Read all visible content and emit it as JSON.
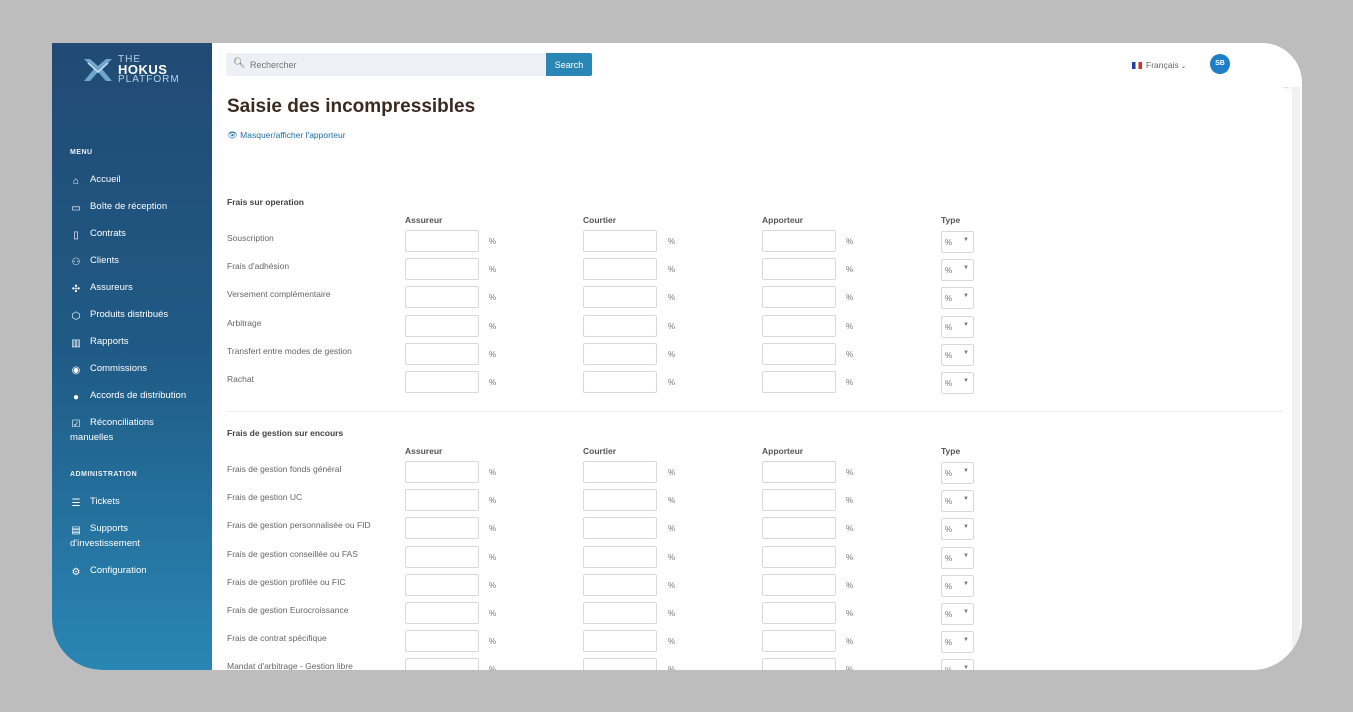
{
  "brand": {
    "line1": "THE",
    "line2": "HOKUS",
    "line3": "PLATFORM"
  },
  "sidebar": {
    "menu_title": "MENU",
    "items": [
      {
        "label": "Accueil",
        "icon": "home-icon"
      },
      {
        "label": "Boîte de réception",
        "icon": "inbox-icon"
      },
      {
        "label": "Contrats",
        "icon": "clipboard-icon"
      },
      {
        "label": "Clients",
        "icon": "users-icon"
      },
      {
        "label": "Assureurs",
        "icon": "handshake-icon"
      },
      {
        "label": "Produits distribués",
        "icon": "cube-icon"
      },
      {
        "label": "Rapports",
        "icon": "books-icon"
      },
      {
        "label": "Commissions",
        "icon": "coins-icon"
      },
      {
        "label": "Accords de distribution",
        "icon": "chat-icon"
      },
      {
        "label": "Réconciliations manuelles",
        "icon": "check-square-icon"
      }
    ],
    "admin_title": "ADMINISTRATION",
    "admin_items": [
      {
        "label": "Tickets",
        "icon": "list-check-icon"
      },
      {
        "label": "Supports d'investissement",
        "icon": "id-card-icon"
      },
      {
        "label": "Configuration",
        "icon": "gear-icon"
      }
    ]
  },
  "topbar": {
    "search_placeholder": "Rechercher",
    "search_button": "Search",
    "language": "Français",
    "user_initials": "SB"
  },
  "page": {
    "title": "Saisie des incompressibles",
    "toggle_link": "Masquer/afficher l'apporteur",
    "columns": [
      "Assureur",
      "Courtier",
      "Apporteur",
      "Type"
    ],
    "unit": "%",
    "type_value": "%",
    "sections": [
      {
        "title": "Frais sur operation",
        "rows": [
          "Souscription",
          "Frais d'adhésion",
          "Versement complémentaire",
          "Arbitrage",
          "Transfert entre modes de gestion",
          "Rachat"
        ]
      },
      {
        "title": "Frais de gestion sur encours",
        "rows": [
          "Frais de gestion fonds général",
          "Frais de gestion UC",
          "Frais de gestion personnalisée ou FID",
          "Frais de gestion conseillée ou FAS",
          "Frais de gestion profilée ou FIC",
          "Frais de gestion Eurocroissance",
          "Frais de contrat spécifique",
          "Mandat d'arbitrage - Gestion libre"
        ]
      }
    ]
  }
}
